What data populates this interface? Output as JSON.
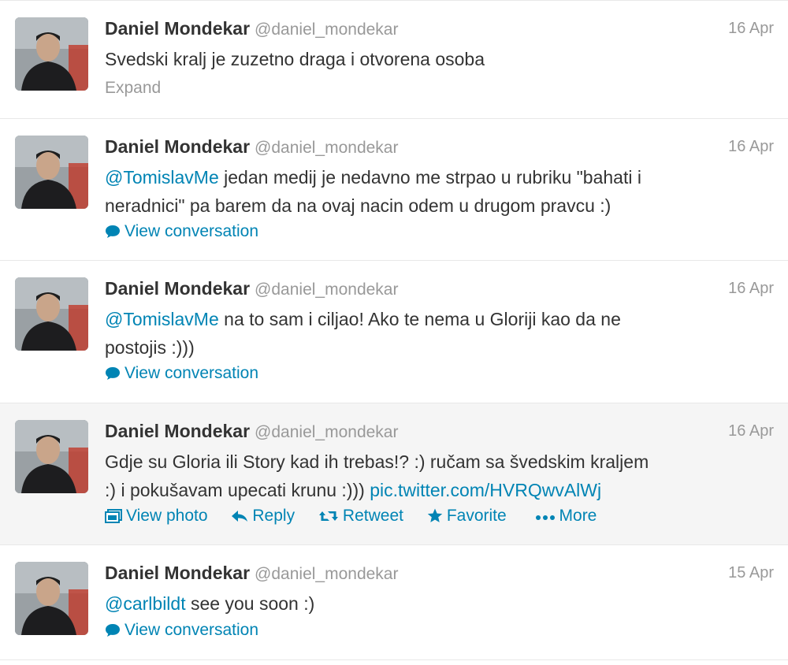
{
  "tweets": [
    {
      "fullname": "Daniel Mondekar",
      "username": "@daniel_mondekar",
      "time": "16 Apr",
      "text_parts": [
        "Svedski kralj je zuzetno draga i otvorena osoba"
      ],
      "expand_label": "Expand"
    },
    {
      "fullname": "Daniel Mondekar",
      "username": "@daniel_mondekar",
      "time": "16 Apr",
      "mention": "@TomislavMe",
      "text_line1": " jedan medij je nedavno me strpao u rubriku \"bahati i",
      "text_line2": "neradnici\" pa barem da na ovaj nacin odem u drugom pravcu :)",
      "view_conversation": "View conversation"
    },
    {
      "fullname": "Daniel Mondekar",
      "username": "@daniel_mondekar",
      "time": "16 Apr",
      "mention": "@TomislavMe",
      "text_line1": " na to sam i ciljao! Ako te nema u Gloriji kao da ne",
      "text_line2": "postojis :)))",
      "view_conversation": "View conversation"
    },
    {
      "fullname": "Daniel Mondekar",
      "username": "@daniel_mondekar",
      "time": "16 Apr",
      "text_line1": "Gdje su Gloria ili Story kad ih trebas!? :) ručam sa švedskim kraljem",
      "text_line2": ":) i pokušavam upecati krunu :))) ",
      "link": "pic.twitter.com/HVRQwvAlWj",
      "actions": {
        "view_photo": "View photo",
        "reply": "Reply",
        "retweet": "Retweet",
        "favorite": "Favorite",
        "more": "More"
      }
    },
    {
      "fullname": "Daniel Mondekar",
      "username": "@daniel_mondekar",
      "time": "15 Apr",
      "mention": "@carlbildt",
      "text_line1": " see you soon :)",
      "view_conversation": "View conversation"
    }
  ],
  "colors": {
    "link": "#0084b4",
    "muted": "#999999",
    "text": "#333333",
    "hover_row": "#f5f5f5",
    "divider": "#e8e8e8"
  },
  "icons": {
    "conversation": "speech-bubble-icon",
    "photo": "photo-icon",
    "reply": "reply-arrow-icon",
    "retweet": "retweet-icon",
    "favorite": "star-icon",
    "more": "ellipsis-icon"
  }
}
